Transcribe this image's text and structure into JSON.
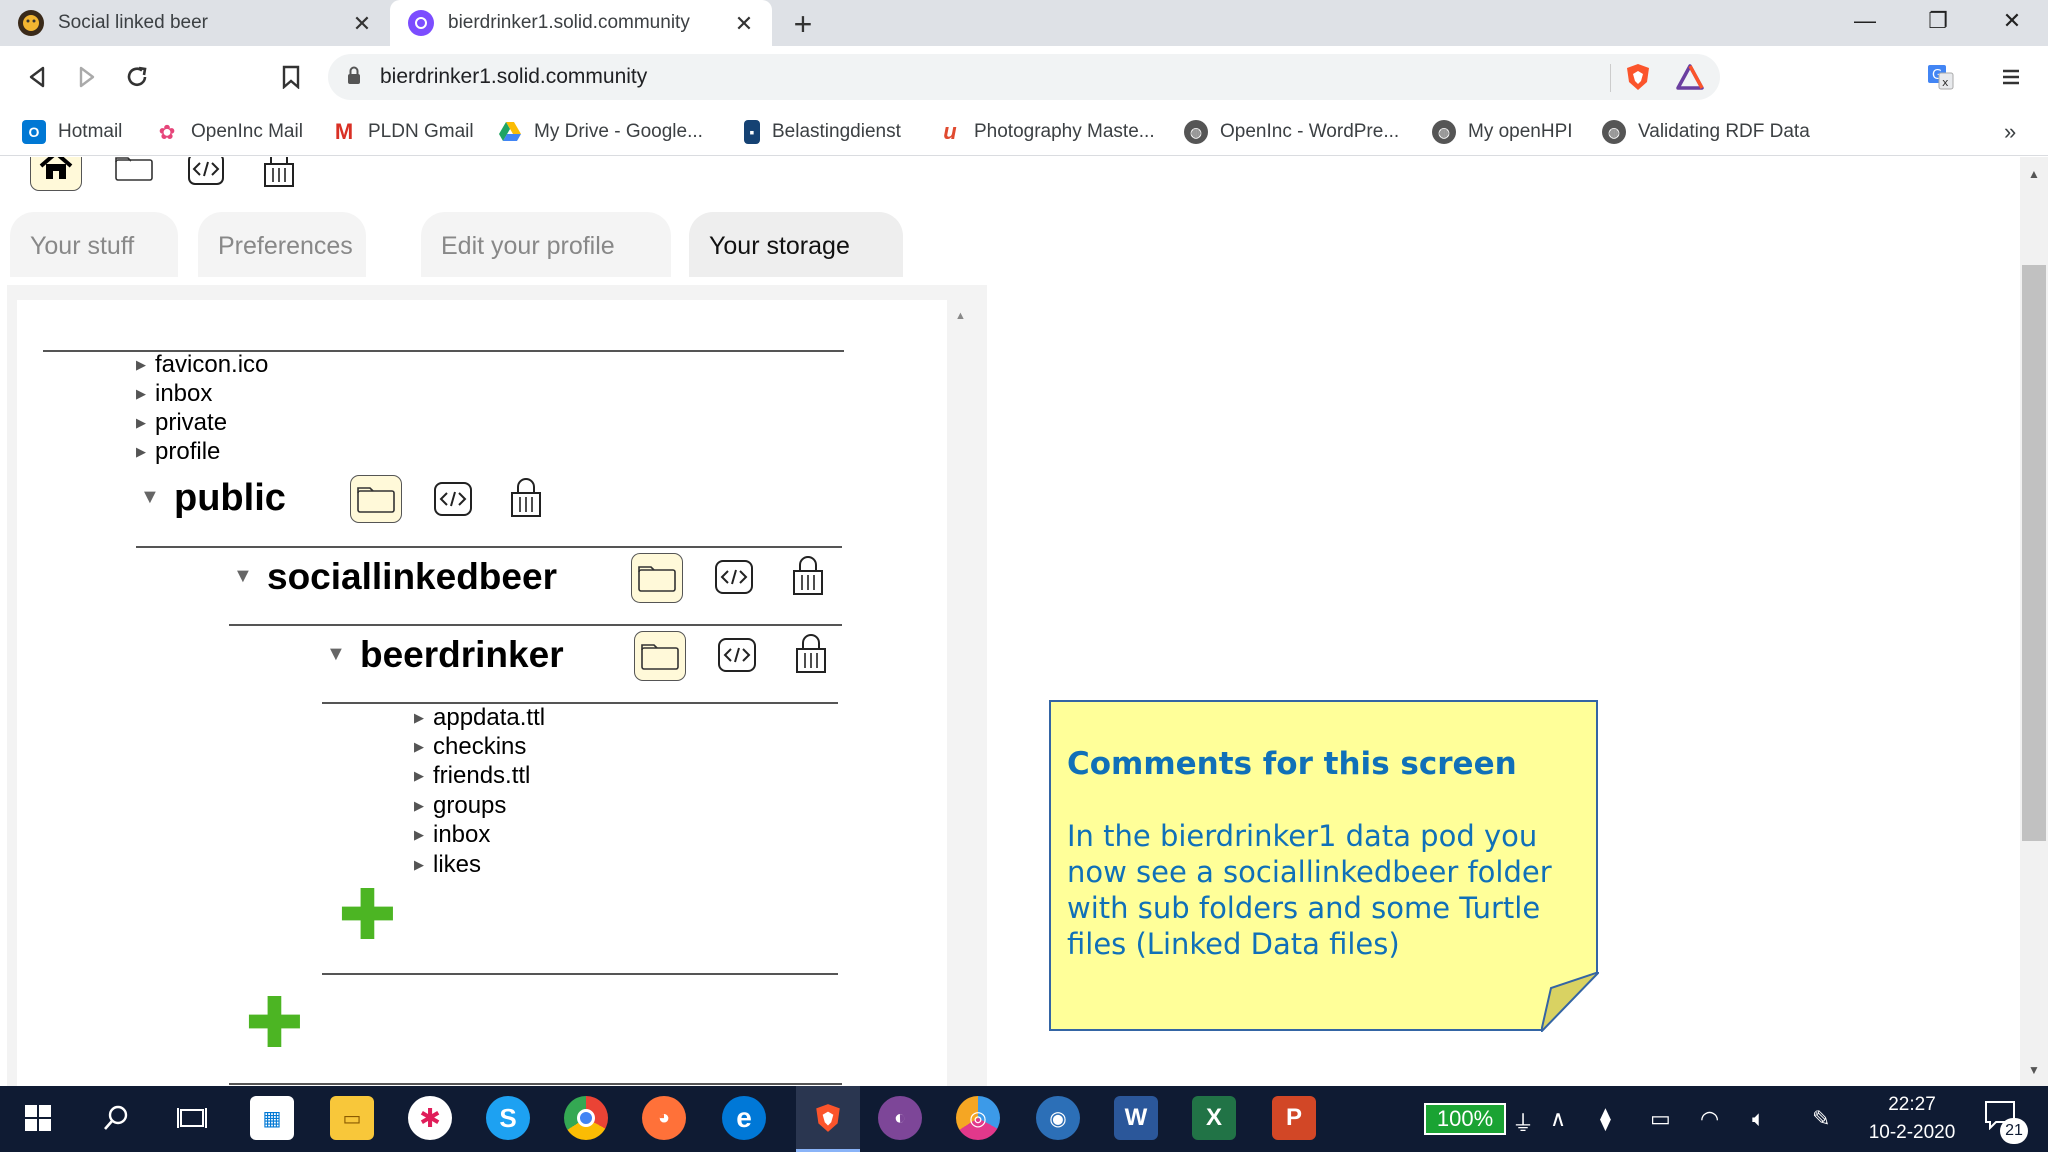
{
  "browser": {
    "tabs": [
      {
        "title": "Social linked beer",
        "active": false
      },
      {
        "title": "bierdrinker1.solid.community",
        "active": true
      }
    ],
    "address": "bierdrinker1.solid.community",
    "bookmarks": [
      {
        "label": "Hotmail",
        "color": "#0078d4"
      },
      {
        "label": "OpenInc Mail",
        "color": "#e6457a"
      },
      {
        "label": "PLDN Gmail",
        "color": "#d93025"
      },
      {
        "label": "My Drive - Google...",
        "color": "#1fa463"
      },
      {
        "label": "Belastingdienst",
        "color": "#154273"
      },
      {
        "label": "Photography Maste...",
        "color": "#e04a2f"
      },
      {
        "label": "OpenInc - WordPre...",
        "color": "#555555"
      },
      {
        "label": "My openHPI",
        "color": "#555555"
      },
      {
        "label": "Validating RDF Data",
        "color": "#555555"
      }
    ],
    "bookmarks_overflow": "»"
  },
  "page": {
    "tabs": [
      {
        "label": "Your stuff",
        "active": false
      },
      {
        "label": "Preferences",
        "active": false
      },
      {
        "label": "Edit your profile",
        "active": false
      },
      {
        "label": "Your storage",
        "active": true
      }
    ],
    "root_items": [
      "favicon.ico",
      "inbox",
      "private",
      "profile"
    ],
    "folders": {
      "public": "public",
      "sociallinkedbeer": "sociallinkedbeer",
      "beerdrinker": "beerdrinker"
    },
    "beerdrinker_items": [
      "appdata.ttl",
      "checkins",
      "friends.ttl",
      "groups",
      "inbox",
      "likes"
    ],
    "add_symbol": "✚"
  },
  "comment": {
    "title": "Comments for this screen",
    "body": "In the bierdrinker1 data pod you now see a sociallinkedbeer folder with sub folders and some Turtle files (Linked Data files)"
  },
  "taskbar": {
    "battery": "100%",
    "time": "22:27",
    "date": "10-2-2020",
    "notifications": "21"
  },
  "colors": {
    "accent_plus": "#4cb523",
    "note_bg": "#ffff99",
    "note_text": "#1070b8",
    "note_border": "#3465a4"
  }
}
